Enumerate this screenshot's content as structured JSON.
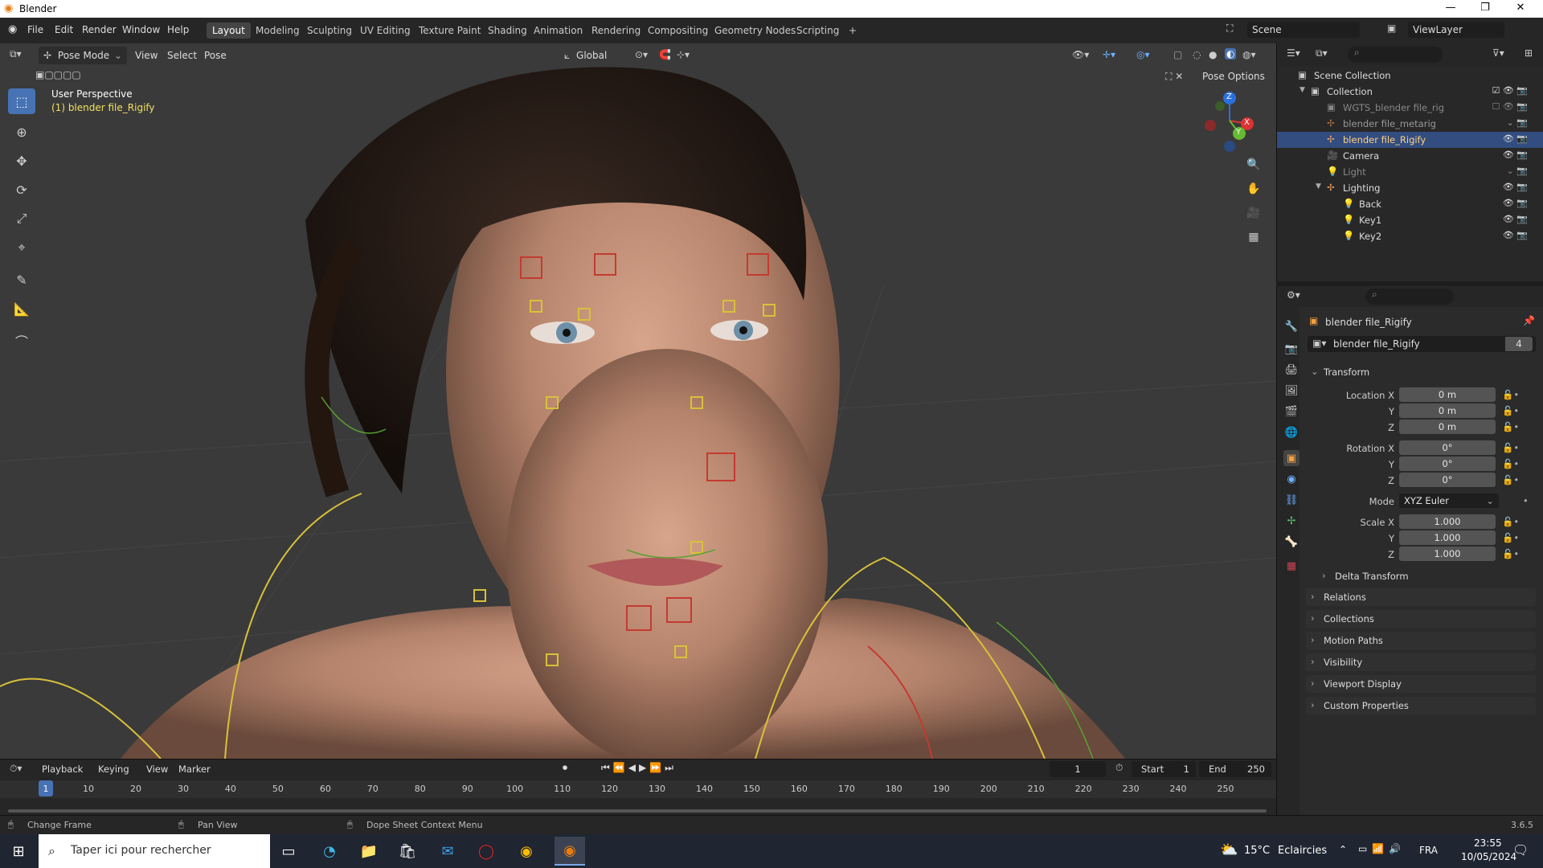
{
  "window": {
    "title": "Blender",
    "min": "—",
    "max": "❐",
    "close": "✕"
  },
  "menu": {
    "items": [
      "File",
      "Edit",
      "Render",
      "Window",
      "Help"
    ]
  },
  "workspaces": [
    "Layout",
    "Modeling",
    "Sculpting",
    "UV Editing",
    "Texture Paint",
    "Shading",
    "Animation",
    "Rendering",
    "Compositing",
    "Geometry Nodes",
    "Scripting",
    "+"
  ],
  "scene": {
    "name": "Scene",
    "view_layer": "ViewLayer"
  },
  "viewport": {
    "mode": "Pose Mode",
    "menus": [
      "View",
      "Select",
      "Pose"
    ],
    "orientation": "Global",
    "overlay_title": "User Perspective",
    "overlay_object": "(1) blender file_Rigify",
    "pose_options": "Pose Options",
    "gizmo": {
      "x": "X",
      "y": "Y",
      "z": "Z"
    }
  },
  "outliner": {
    "rows": [
      {
        "label": "Scene Collection"
      },
      {
        "label": "Collection"
      },
      {
        "label": "WGTS_blender file_rig"
      },
      {
        "label": "blender file_metarig"
      },
      {
        "label": "blender file_Rigify"
      },
      {
        "label": "Camera"
      },
      {
        "label": "Light"
      },
      {
        "label": "Lighting"
      },
      {
        "label": "Back"
      },
      {
        "label": "Key1"
      },
      {
        "label": "Key2"
      }
    ]
  },
  "properties": {
    "object_name": "blender file_Rigify",
    "data_name": "blender file_Rigify",
    "users": "4",
    "transform_title": "Transform",
    "location": {
      "label_x": "Location X",
      "x": "0 m",
      "label_y": "Y",
      "y": "0 m",
      "label_z": "Z",
      "z": "0 m"
    },
    "rotation": {
      "label_x": "Rotation X",
      "x": "0°",
      "label_y": "Y",
      "y": "0°",
      "label_z": "Z",
      "z": "0°"
    },
    "mode": {
      "label": "Mode",
      "value": "XYZ Euler"
    },
    "scale": {
      "label_x": "Scale X",
      "x": "1.000",
      "label_y": "Y",
      "y": "1.000",
      "label_z": "Z",
      "z": "1.000"
    },
    "delta": "Delta Transform",
    "panels": [
      "Relations",
      "Collections",
      "Motion Paths",
      "Visibility",
      "Viewport Display",
      "Custom Properties"
    ]
  },
  "timeline": {
    "menus": [
      "Playback",
      "Keying",
      "View",
      "Marker"
    ],
    "current_frame": "1",
    "start_label": "Start",
    "start": "1",
    "end_label": "End",
    "end": "250",
    "ticks": [
      "1",
      "10",
      "20",
      "30",
      "40",
      "50",
      "60",
      "70",
      "80",
      "90",
      "100",
      "110",
      "120",
      "130",
      "140",
      "150",
      "160",
      "170",
      "180",
      "190",
      "200",
      "210",
      "220",
      "230",
      "240",
      "250"
    ]
  },
  "status": {
    "left": "Change Frame",
    "middle": "Pan View",
    "right": "Dope Sheet Context Menu",
    "version": "3.6.5"
  },
  "taskbar": {
    "search": "Taper ici pour rechercher",
    "weather_temp": "15°C",
    "weather_text": "Eclaircies",
    "lang": "FRA",
    "time": "23:55",
    "date": "10/05/2024"
  }
}
